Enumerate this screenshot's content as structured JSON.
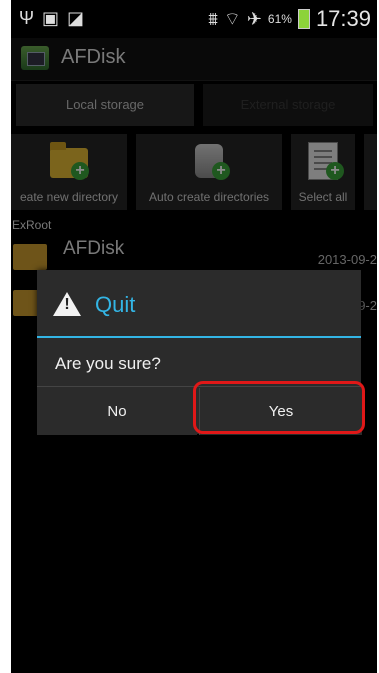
{
  "status_bar": {
    "icons": [
      "usb-icon",
      "image-icon",
      "clipboard-icon",
      "signal-icon",
      "wifi-icon",
      "airplane-icon"
    ],
    "battery_percent": "61%",
    "time": "17:39"
  },
  "app": {
    "title": "AFDisk"
  },
  "tabs": {
    "local": "Local storage",
    "external": "External storage"
  },
  "toolbar": {
    "create_dir": "eate new directory",
    "auto_create": "Auto create directories",
    "select_all": "Select all"
  },
  "list": {
    "breadcrumb": "ExRoot",
    "rows": [
      {
        "name": "AFDisk",
        "date": "2013-09-2"
      },
      {
        "name": "",
        "date": "9-2"
      }
    ]
  },
  "dialog": {
    "title": "Quit",
    "message": "Are you sure?",
    "no_label": "No",
    "yes_label": "Yes"
  },
  "colors": {
    "accent": "#33b5e5",
    "highlight": "#e01818",
    "background": "#000000"
  }
}
